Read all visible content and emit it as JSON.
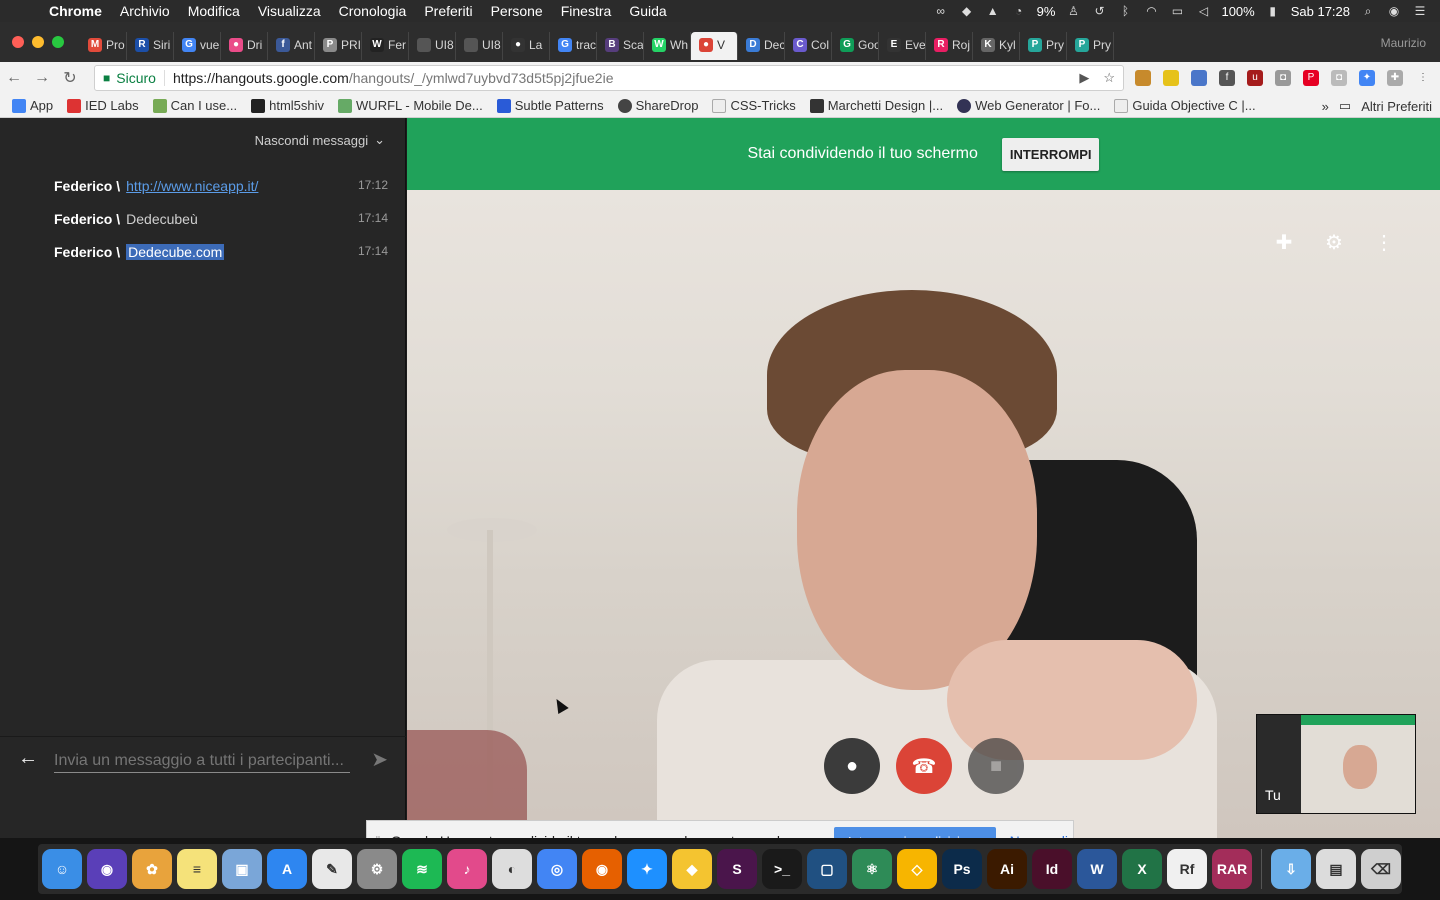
{
  "menubar": {
    "app": "Chrome",
    "items": [
      "Archivio",
      "Modifica",
      "Visualizza",
      "Cronologia",
      "Preferiti",
      "Persone",
      "Finestra",
      "Guida"
    ],
    "battery": "100%",
    "cpu": "9%",
    "clock": "Sab 17:28"
  },
  "browser": {
    "tabs": [
      {
        "label": "Pro",
        "color": "#e14b3b",
        "glyph": "M"
      },
      {
        "label": "Siri",
        "color": "#1c4fa8",
        "glyph": "R"
      },
      {
        "label": "vue",
        "color": "#4285f4",
        "glyph": "G"
      },
      {
        "label": "Dri",
        "color": "#ea4c89",
        "glyph": "●"
      },
      {
        "label": "Ant",
        "color": "#3b5998",
        "glyph": "f"
      },
      {
        "label": "PRI",
        "color": "#8a8a8a",
        "glyph": "P"
      },
      {
        "label": "Fer",
        "color": "#222222",
        "glyph": "W"
      },
      {
        "label": "UI8",
        "color": "#555555",
        "glyph": ""
      },
      {
        "label": "UI8",
        "color": "#555555",
        "glyph": ""
      },
      {
        "label": "La",
        "color": "#333333",
        "glyph": "●"
      },
      {
        "label": "trac",
        "color": "#4285f4",
        "glyph": "G"
      },
      {
        "label": "Sca",
        "color": "#563d7c",
        "glyph": "B"
      },
      {
        "label": "Wh",
        "color": "#25d366",
        "glyph": "W"
      },
      {
        "label": "V",
        "color": "#db4437",
        "glyph": "●"
      },
      {
        "label": "Dec",
        "color": "#3a7bd5",
        "glyph": "D"
      },
      {
        "label": "Col",
        "color": "#6a5acd",
        "glyph": "C"
      },
      {
        "label": "Goo",
        "color": "#0f9d58",
        "glyph": "G"
      },
      {
        "label": "Eve",
        "color": "#333333",
        "glyph": "E"
      },
      {
        "label": "Roj",
        "color": "#e91e63",
        "glyph": "R"
      },
      {
        "label": "Kyl",
        "color": "#666666",
        "glyph": "K"
      },
      {
        "label": "Pry",
        "color": "#26a69a",
        "glyph": "P"
      },
      {
        "label": "Pry",
        "color": "#26a69a",
        "glyph": "P"
      }
    ],
    "active_tab_index": 13,
    "profile": "Maurizio",
    "secure_label": "Sicuro",
    "url_host": "https://hangouts.google.com",
    "url_path": "/hangouts/_/ymlwd7uybvd73d5t5pj2jfue2ie",
    "bookmarks": [
      "App",
      "IED Labs",
      "Can I use...",
      "html5shiv",
      "WURFL - Mobile De...",
      "Subtle Patterns",
      "ShareDrop",
      "CSS-Tricks",
      "Marchetti Design |...",
      "Web Generator | Fo...",
      "Guida Objective C |..."
    ],
    "bookmarks_other": "Altri Preferiti"
  },
  "chat": {
    "hide_label": "Nascondi messaggi",
    "messages": [
      {
        "sender": "Federico \\",
        "text": "http://www.niceapp.it/",
        "time": "17:12"
      },
      {
        "sender": "Federico \\",
        "text": "Dedecubeù",
        "time": "17:14"
      },
      {
        "sender": "Federico \\",
        "text": "Dedecube.com",
        "time": "17:14"
      }
    ],
    "input_placeholder": "Invia un messaggio a tutti i partecipanti..."
  },
  "share_banner": {
    "text": "Stai condividendo il tuo schermo",
    "stop_label": "INTERROMPI"
  },
  "self_view": {
    "label": "Tu"
  },
  "share_notice": {
    "text": "Google Hangouts condivide il tuo schermo con hangouts.google.com.",
    "stop_label": "Interrompi condivisione",
    "hide_label": "Nascondi"
  },
  "dock": [
    {
      "name": "finder",
      "color": "#3a8ee6",
      "glyph": "☺"
    },
    {
      "name": "siri",
      "color": "#5a3fb8",
      "glyph": "◉"
    },
    {
      "name": "photos",
      "color": "#e8a33c",
      "glyph": "✿"
    },
    {
      "name": "notes",
      "color": "#f5e27a",
      "glyph": "≡"
    },
    {
      "name": "preview",
      "color": "#7aa6d8",
      "glyph": "▣"
    },
    {
      "name": "app-store",
      "color": "#2e86f0",
      "glyph": "A"
    },
    {
      "name": "textedit",
      "color": "#e8e8e8",
      "glyph": "✎"
    },
    {
      "name": "system-preferences",
      "color": "#8a8a8a",
      "glyph": "⚙"
    },
    {
      "name": "spotify",
      "color": "#1db954",
      "glyph": "≋"
    },
    {
      "name": "itunes",
      "color": "#e24a8b",
      "glyph": "♪"
    },
    {
      "name": "sequel-pro",
      "color": "#dddddd",
      "glyph": "◐"
    },
    {
      "name": "chrome",
      "color": "#4285f4",
      "glyph": "◎"
    },
    {
      "name": "firefox",
      "color": "#e66000",
      "glyph": "◉"
    },
    {
      "name": "safari",
      "color": "#1e90ff",
      "glyph": "✦"
    },
    {
      "name": "cyberduck",
      "color": "#f4c430",
      "glyph": "◆"
    },
    {
      "name": "slack",
      "color": "#4a154b",
      "glyph": "S"
    },
    {
      "name": "terminal",
      "color": "#1a1a1a",
      "glyph": ">_"
    },
    {
      "name": "sourcetree",
      "color": "#205081",
      "glyph": "▢"
    },
    {
      "name": "atom",
      "color": "#2e8b57",
      "glyph": "⚛"
    },
    {
      "name": "sketch",
      "color": "#f7b500",
      "glyph": "◇"
    },
    {
      "name": "photoshop",
      "color": "#0c2b4a",
      "glyph": "Ps"
    },
    {
      "name": "illustrator",
      "color": "#3b1a00",
      "glyph": "Ai"
    },
    {
      "name": "indesign",
      "color": "#4a0f2a",
      "glyph": "Id"
    },
    {
      "name": "word",
      "color": "#2b579a",
      "glyph": "W"
    },
    {
      "name": "excel",
      "color": "#217346",
      "glyph": "X"
    },
    {
      "name": "reflector",
      "color": "#f0f0f0",
      "glyph": "Rf"
    },
    {
      "name": "the-unarchiver",
      "color": "#a32d5a",
      "glyph": "RAR"
    },
    {
      "name": "downloads",
      "color": "#6aaee8",
      "glyph": "⇩"
    },
    {
      "name": "recent-files",
      "color": "#dcdcdc",
      "glyph": "▤"
    },
    {
      "name": "trash",
      "color": "#cfcfcf",
      "glyph": "⌫"
    }
  ]
}
